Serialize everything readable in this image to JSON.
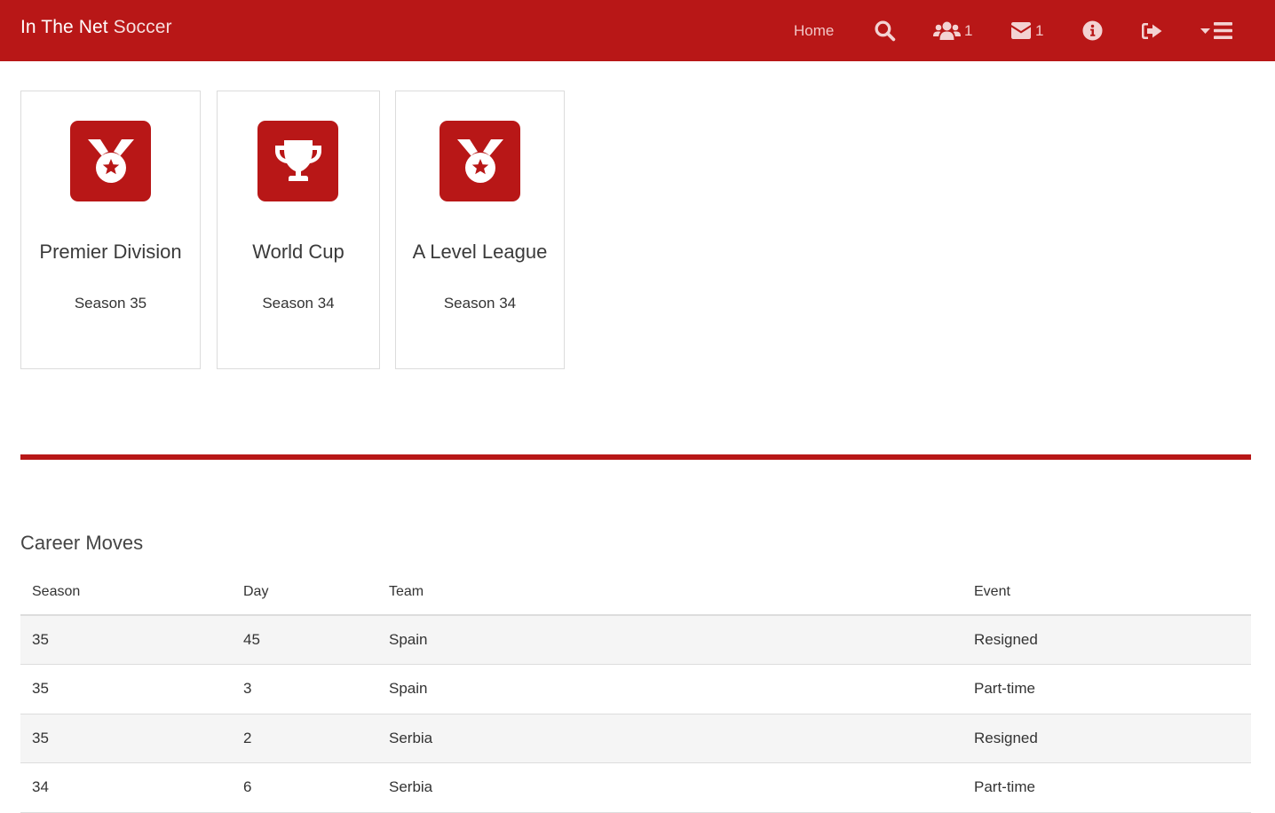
{
  "navbar": {
    "brand_bold": "In The Net",
    "brand_thin": "Soccer",
    "home_label": "Home",
    "items": [
      {
        "icon": "search-icon"
      },
      {
        "icon": "users-icon",
        "count": "1"
      },
      {
        "icon": "envelope-icon",
        "count": "1"
      },
      {
        "icon": "info-circle-icon"
      },
      {
        "icon": "sign-out-icon"
      },
      {
        "icon": "menu-icon",
        "has_caret": true
      }
    ],
    "colors": {
      "background": "#B81717",
      "icon": "#F3D3D3"
    }
  },
  "competitions": [
    {
      "icon": "medal-icon",
      "title": "Premier Division",
      "season": "Season 35"
    },
    {
      "icon": "trophy-icon",
      "title": "World Cup",
      "season": "Season 34"
    },
    {
      "icon": "medal-icon",
      "title": "A Level League",
      "season": "Season 34"
    }
  ],
  "career": {
    "title": "Career Moves",
    "columns": [
      "Season",
      "Day",
      "Team",
      "Event"
    ],
    "rows": [
      [
        "35",
        "45",
        "Spain",
        "Resigned"
      ],
      [
        "35",
        "3",
        "Spain",
        "Part-time"
      ],
      [
        "35",
        "2",
        "Serbia",
        "Resigned"
      ],
      [
        "34",
        "6",
        "Serbia",
        "Part-time"
      ]
    ]
  }
}
